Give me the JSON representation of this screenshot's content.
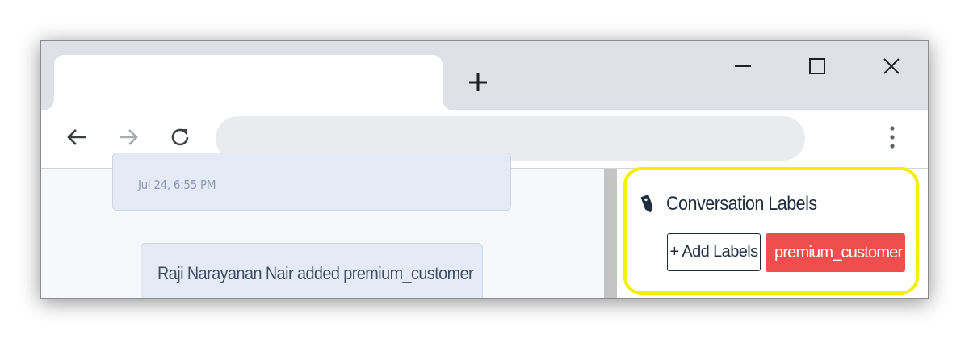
{
  "browser": {
    "new_tab_icon": "plus-icon",
    "window_controls": [
      "minimize-icon",
      "maximize-icon",
      "close-icon"
    ],
    "nav": [
      "back-arrow-icon",
      "forward-arrow-icon",
      "reload-icon"
    ],
    "menu_icon": "more-vert-icon"
  },
  "chat": {
    "timestamp": "Jul 24, 6:55 PM",
    "activity_message": "Raji Narayanan Nair added premium_customer"
  },
  "sidebar": {
    "title_icon": "tag-icon",
    "title": "Conversation Labels",
    "add_button_label": "+ Add Labels",
    "labels": [
      {
        "name": "premium_customer",
        "remove": "X",
        "color": "#ef4e4e"
      }
    ],
    "highlight_color": "#f3f000"
  }
}
